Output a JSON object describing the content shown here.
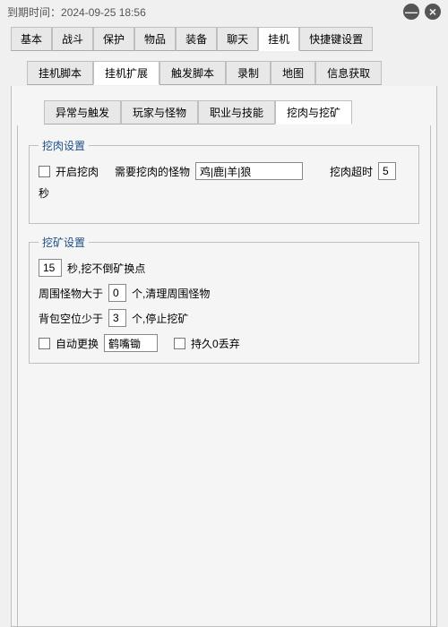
{
  "titlebar": {
    "expire_label": "到期时间：",
    "expire_value": "2024-09-25 18:56",
    "minimize": "—",
    "close": "×"
  },
  "tabs1": {
    "items": [
      "基本",
      "战斗",
      "保护",
      "物品",
      "装备",
      "聊天",
      "挂机",
      "快捷键设置"
    ],
    "active": 6
  },
  "tabs2": {
    "items": [
      "挂机脚本",
      "挂机扩展",
      "触发脚本",
      "录制",
      "地图",
      "信息获取"
    ],
    "active": 1
  },
  "tabs3": {
    "items": [
      "异常与触发",
      "玩家与怪物",
      "职业与技能",
      "挖肉与挖矿"
    ],
    "active": 3
  },
  "meat": {
    "legend": "挖肉设置",
    "enable_label": "开启挖肉",
    "need_label": "需要挖肉的怪物",
    "monsters_value": "鸡|鹿|羊|狼",
    "timeout_label": "挖肉超时",
    "timeout_value": "5",
    "timeout_unit": "秒"
  },
  "mine": {
    "legend": "挖矿设置",
    "switch_timeout_value": "15",
    "switch_timeout_text": "秒,挖不倒矿换点",
    "around_prefix": "周围怪物大于",
    "around_value": "0",
    "around_suffix": "个,清理周围怪物",
    "bag_prefix": "背包空位少于",
    "bag_value": "3",
    "bag_suffix": "个,停止挖矿",
    "auto_swap_label": "自动更换",
    "tool_value": "鹤嘴锄",
    "discard_label": "持久0丢弃"
  }
}
